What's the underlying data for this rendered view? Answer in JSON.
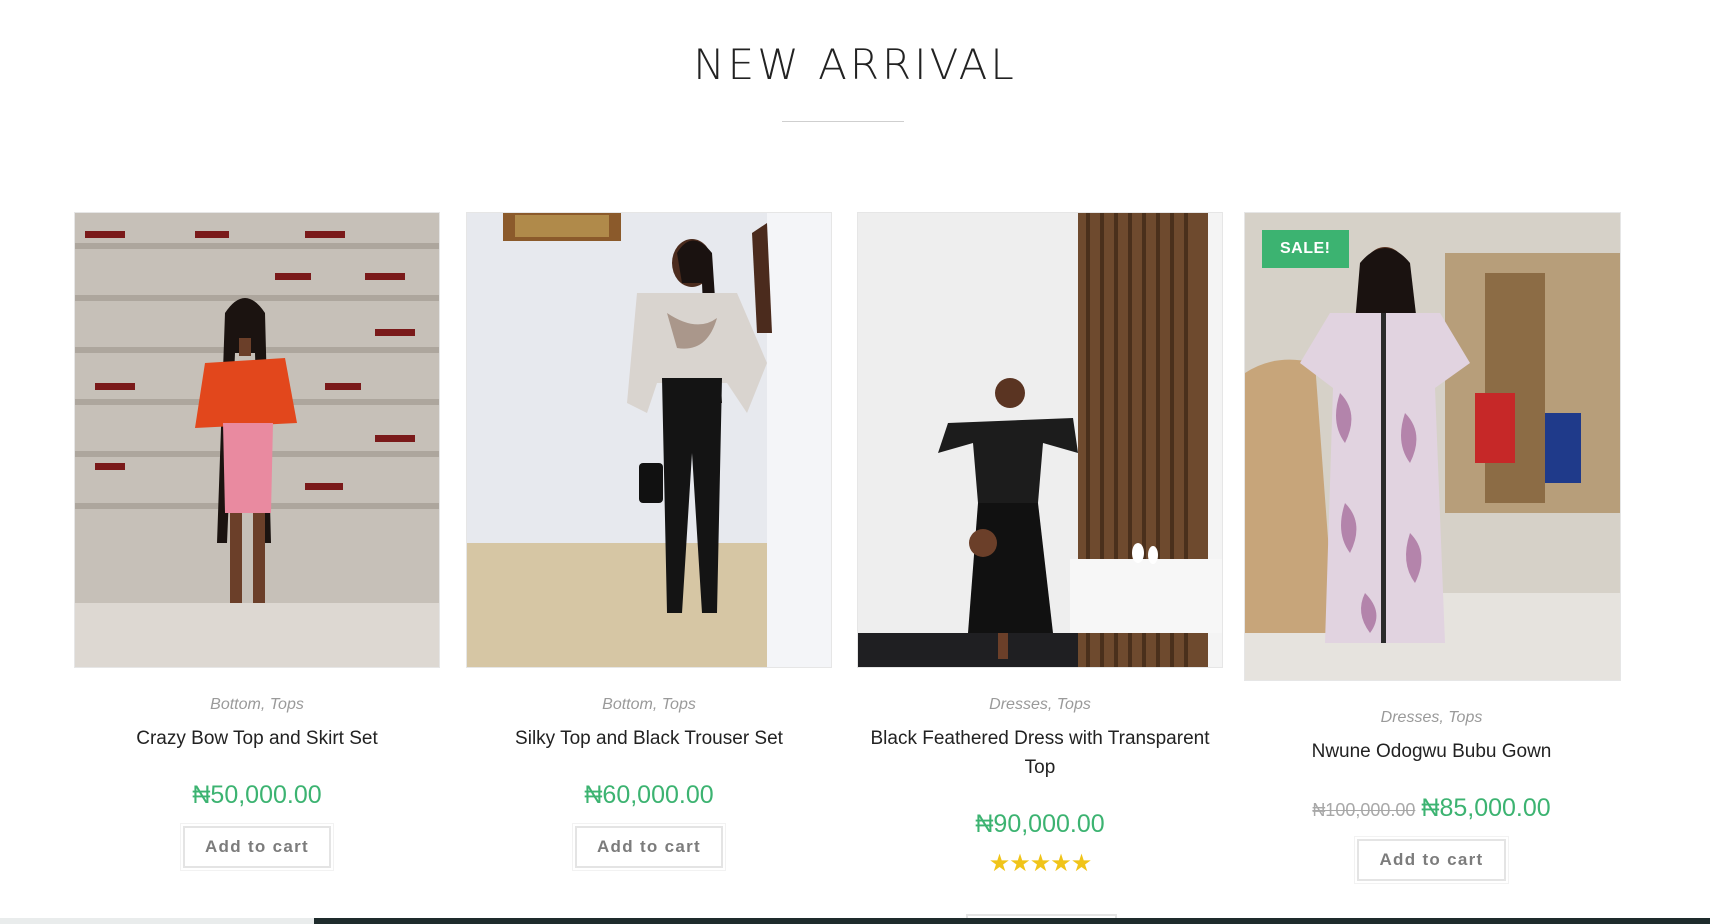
{
  "section": {
    "title": "NEW ARRIVAL"
  },
  "products": [
    {
      "categories": [
        "Bottom",
        "Tops"
      ],
      "name": "Crazy Bow Top and Skirt Set",
      "price": "₦50,000.00",
      "button": "Add to cart",
      "image_alt": "Woman in orange bow top and pink skirt in front of a wine wall"
    },
    {
      "categories": [
        "Bottom",
        "Tops"
      ],
      "name": "Silky Top and Black Trouser Set",
      "price": "₦60,000.00",
      "button": "Add to cart",
      "image_alt": "Woman in silky printed top and black trousers"
    },
    {
      "categories": [
        "Dresses",
        "Tops"
      ],
      "name": "Black Feathered Dress with Transparent Top",
      "price": "₦90,000.00",
      "rating_stars": "★★★★★",
      "rating_value": 5,
      "image_alt": "Woman in black feathered dress next to wooden panel wall"
    },
    {
      "badge": "SALE!",
      "categories": [
        "Dresses",
        "Tops"
      ],
      "name": "Nwune Odogwu Bubu Gown",
      "old_price": "₦100,000.00",
      "price": "₦85,000.00",
      "button": "Add to cart",
      "image_alt": "Woman in patterned bubu gown in a living room"
    }
  ],
  "colors": {
    "price_green": "#3cb371",
    "sale_badge": "#3cb371",
    "star": "#f0c419",
    "footer_bar": "#1e2b2c"
  }
}
